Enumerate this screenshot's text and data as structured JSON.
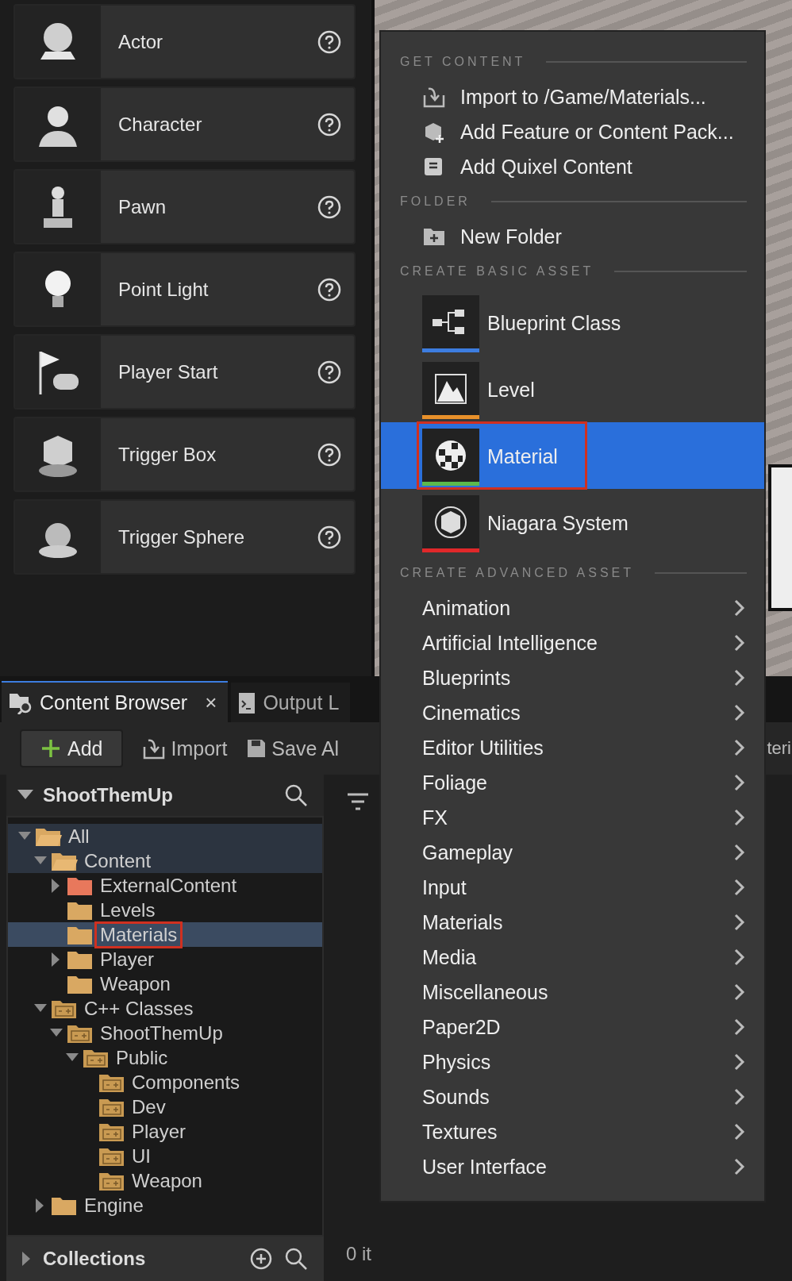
{
  "place_actors": [
    {
      "label": "Actor"
    },
    {
      "label": "Character"
    },
    {
      "label": "Pawn"
    },
    {
      "label": "Point Light"
    },
    {
      "label": "Player Start"
    },
    {
      "label": "Trigger Box"
    },
    {
      "label": "Trigger Sphere"
    }
  ],
  "tabs": [
    {
      "label": "Content Browser",
      "selected": true,
      "close": "×"
    },
    {
      "label": "Output L",
      "selected": false
    }
  ],
  "toolbar": {
    "add": "Add",
    "import": "Import",
    "save": "Save Al",
    "cut_label": "teri"
  },
  "sources": {
    "title": "ShootThemUp",
    "collections": "Collections"
  },
  "tree": [
    {
      "label": "All",
      "kind": "folder",
      "expanded": true,
      "selected": false,
      "outlined": false,
      "children": [
        {
          "label": "Content",
          "kind": "folder",
          "expanded": true,
          "selected": false,
          "outlined": false,
          "children": [
            {
              "label": "ExternalContent",
              "kind": "folder",
              "color": "#e8785c",
              "expanded": false,
              "selected": false,
              "outlined": false
            },
            {
              "label": "Levels",
              "kind": "folder",
              "selected": false,
              "outlined": false
            },
            {
              "label": "Materials",
              "kind": "folder",
              "selected": true,
              "outlined": true
            },
            {
              "label": "Player",
              "kind": "folder",
              "expanded": false,
              "selected": false,
              "outlined": false
            },
            {
              "label": "Weapon",
              "kind": "folder",
              "selected": false,
              "outlined": false
            }
          ]
        },
        {
          "label": "C++ Classes",
          "kind": "cpp",
          "expanded": true,
          "selected": false,
          "outlined": false,
          "children": [
            {
              "label": "ShootThemUp",
              "kind": "cpp",
              "expanded": true,
              "selected": false,
              "outlined": false,
              "children": [
                {
                  "label": "Public",
                  "kind": "cpp",
                  "expanded": true,
                  "selected": false,
                  "outlined": false,
                  "children": [
                    {
                      "label": "Components",
                      "kind": "cpp",
                      "selected": false,
                      "outlined": false
                    },
                    {
                      "label": "Dev",
                      "kind": "cpp",
                      "selected": false,
                      "outlined": false
                    },
                    {
                      "label": "Player",
                      "kind": "cpp",
                      "selected": false,
                      "outlined": false
                    },
                    {
                      "label": "UI",
                      "kind": "cpp",
                      "selected": false,
                      "outlined": false
                    },
                    {
                      "label": "Weapon",
                      "kind": "cpp",
                      "selected": false,
                      "outlined": false
                    }
                  ]
                }
              ]
            }
          ]
        },
        {
          "label": "Engine",
          "kind": "folder",
          "expanded": false,
          "selected": false,
          "outlined": false
        }
      ]
    }
  ],
  "status": "0 it",
  "menu": {
    "get_content": {
      "title": "GET CONTENT",
      "items": [
        "Import to /Game/Materials...",
        "Add Feature or Content Pack...",
        "Add Quixel Content"
      ]
    },
    "folder": {
      "title": "FOLDER",
      "items": [
        "New Folder"
      ]
    },
    "basic": {
      "title": "CREATE BASIC ASSET",
      "items": [
        {
          "label": "Blueprint Class",
          "color": "#3d7de0",
          "selected": false,
          "outlined": false
        },
        {
          "label": "Level",
          "color": "#e8902a",
          "selected": false,
          "outlined": false
        },
        {
          "label": "Material",
          "color": "#5cb84c",
          "selected": true,
          "outlined": true
        },
        {
          "label": "Niagara System",
          "color": "#e0282a",
          "selected": false,
          "outlined": false
        }
      ]
    },
    "advanced": {
      "title": "CREATE ADVANCED ASSET",
      "items": [
        "Animation",
        "Artificial Intelligence",
        "Blueprints",
        "Cinematics",
        "Editor Utilities",
        "Foliage",
        "FX",
        "Gameplay",
        "Input",
        "Materials",
        "Media",
        "Miscellaneous",
        "Paper2D",
        "Physics",
        "Sounds",
        "Textures",
        "User Interface"
      ]
    }
  }
}
